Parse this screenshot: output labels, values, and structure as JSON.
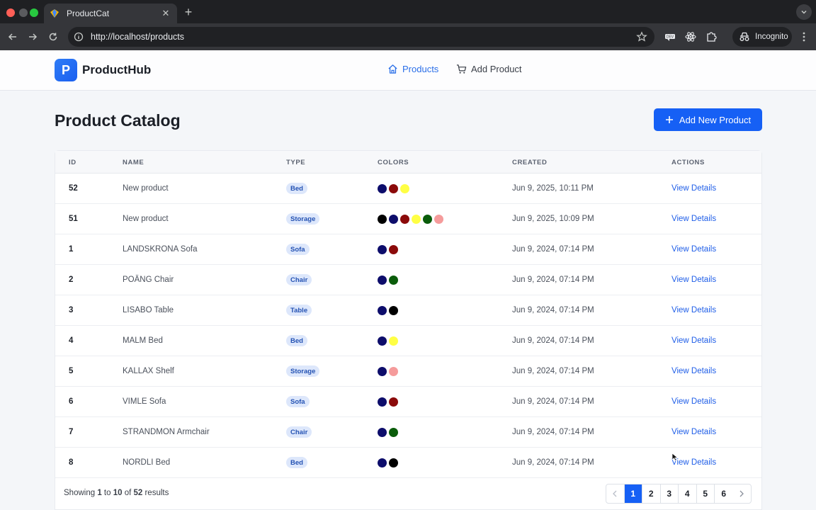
{
  "browser": {
    "tab_title": "ProductCat",
    "url": "http://localhost/products",
    "incognito_label": "Incognito"
  },
  "brand": {
    "logo_letter": "P",
    "name": "ProductHub",
    "accent": "#1660f5"
  },
  "nav": {
    "products": "Products",
    "add_product": "Add Product"
  },
  "page": {
    "title": "Product Catalog",
    "add_button": "Add New Product"
  },
  "table": {
    "headers": {
      "id": "ID",
      "name": "NAME",
      "type": "TYPE",
      "colors": "COLORS",
      "created": "CREATED",
      "actions": "ACTIONS"
    },
    "action_label": "View Details",
    "rows": [
      {
        "id": "52",
        "name": "New product",
        "type": "Bed",
        "colors": [
          "#0d0d6b",
          "#8b0a0a",
          "#ffff44"
        ],
        "created": "Jun 9, 2025, 10:11 PM"
      },
      {
        "id": "51",
        "name": "New product",
        "type": "Storage",
        "colors": [
          "#000000",
          "#0d0d6b",
          "#8b0a0a",
          "#ffff44",
          "#0a5c0a",
          "#f59b9b"
        ],
        "created": "Jun 9, 2025, 10:09 PM"
      },
      {
        "id": "1",
        "name": "LANDSKRONA Sofa",
        "type": "Sofa",
        "colors": [
          "#0d0d6b",
          "#8b0a0a"
        ],
        "created": "Jun 9, 2024, 07:14 PM"
      },
      {
        "id": "2",
        "name": "POÄNG Chair",
        "type": "Chair",
        "colors": [
          "#0d0d6b",
          "#0a5c0a"
        ],
        "created": "Jun 9, 2024, 07:14 PM"
      },
      {
        "id": "3",
        "name": "LISABO Table",
        "type": "Table",
        "colors": [
          "#0d0d6b",
          "#000000"
        ],
        "created": "Jun 9, 2024, 07:14 PM"
      },
      {
        "id": "4",
        "name": "MALM Bed",
        "type": "Bed",
        "colors": [
          "#0d0d6b",
          "#ffff44"
        ],
        "created": "Jun 9, 2024, 07:14 PM"
      },
      {
        "id": "5",
        "name": "KALLAX Shelf",
        "type": "Storage",
        "colors": [
          "#0d0d6b",
          "#f59b9b"
        ],
        "created": "Jun 9, 2024, 07:14 PM"
      },
      {
        "id": "6",
        "name": "VIMLE Sofa",
        "type": "Sofa",
        "colors": [
          "#0d0d6b",
          "#8b0a0a"
        ],
        "created": "Jun 9, 2024, 07:14 PM"
      },
      {
        "id": "7",
        "name": "STRANDMON Armchair",
        "type": "Chair",
        "colors": [
          "#0d0d6b",
          "#0a5c0a"
        ],
        "created": "Jun 9, 2024, 07:14 PM"
      },
      {
        "id": "8",
        "name": "NORDLI Bed",
        "type": "Bed",
        "colors": [
          "#0d0d6b",
          "#000000"
        ],
        "created": "Jun 9, 2024, 07:14 PM"
      }
    ]
  },
  "footer": {
    "showing_prefix": "Showing ",
    "from": "1",
    "to_word": " to ",
    "to": "10",
    "of_word": " of ",
    "total": "52",
    "results_word": " results"
  },
  "pagination": {
    "prev_icon": "chevron-left-icon",
    "next_icon": "chevron-right-icon",
    "pages": [
      "1",
      "2",
      "3",
      "4",
      "5",
      "6"
    ],
    "current": "1"
  }
}
